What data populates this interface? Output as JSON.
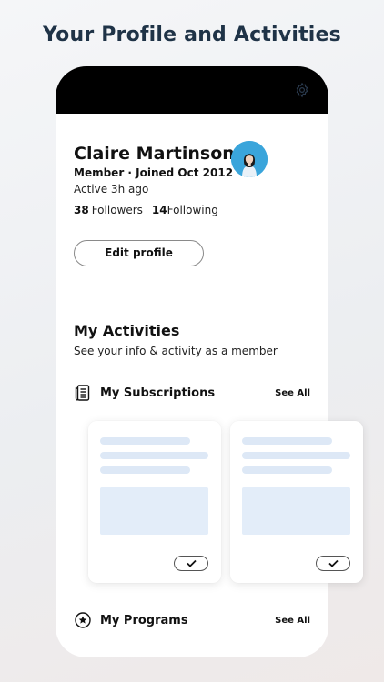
{
  "headline": "Your Profile and Activities",
  "profile": {
    "name": "Claire Martinson",
    "meta": "Member · Joined Oct 2012",
    "active": "Active 3h ago",
    "followers_count": "38",
    "followers_label": "Followers",
    "following_count": "14",
    "following_label": "Following",
    "edit_label": "Edit profile"
  },
  "activities": {
    "title": "My Activities",
    "subtitle": "See your info & activity as a member",
    "subscriptions": {
      "label": "My Subscriptions",
      "see_all": "See All",
      "icon": "newspaper-icon"
    },
    "programs": {
      "label": "My Programs",
      "see_all": "See All",
      "icon": "star-circle-icon"
    }
  },
  "colors": {
    "headline": "#1f3347",
    "avatar_bg": "#3aa5db",
    "placeholder": "#dde8f6"
  }
}
